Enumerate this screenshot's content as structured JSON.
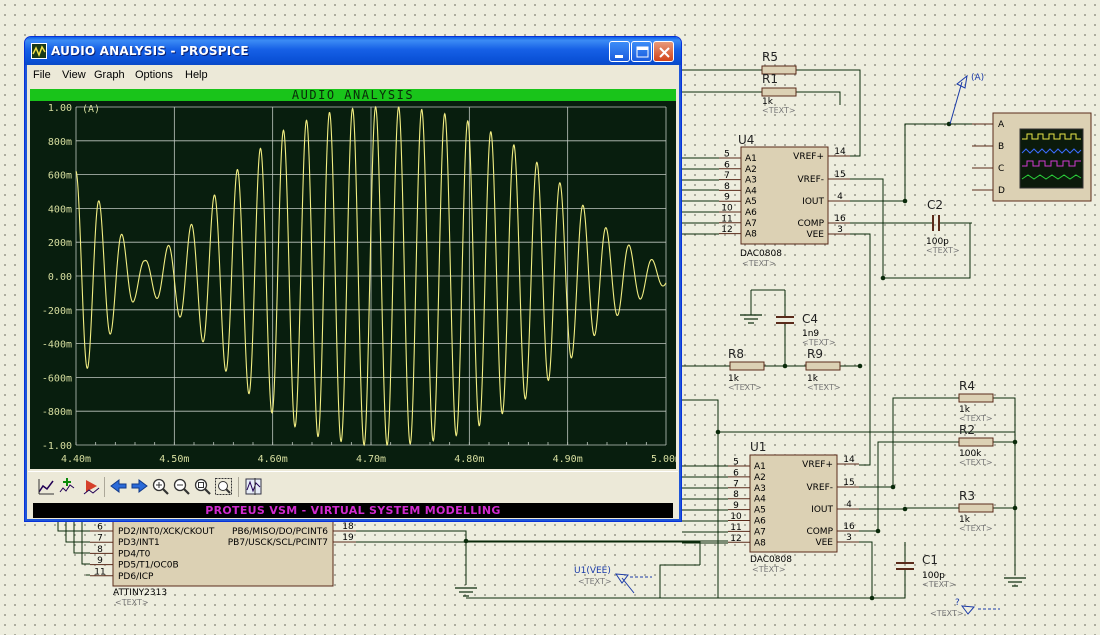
{
  "window": {
    "title": "AUDIO ANALYSIS - PROSPICE",
    "menu": [
      "File",
      "View",
      "Graph",
      "Options",
      "Help"
    ],
    "status": "PROTEUS VSM - VIRTUAL SYSTEM MODELLING",
    "toolbar_icons": [
      "graph-settings-icon",
      "add-trace-icon",
      "run-simulation-icon",
      "pan-left-icon",
      "pan-right-icon",
      "zoom-in-icon",
      "zoom-out-icon",
      "zoom-all-icon",
      "zoom-area-icon",
      "waveform-icon"
    ],
    "controls": {
      "minimize": "minimize-icon",
      "maximize": "maximize-icon",
      "close": "close-icon"
    }
  },
  "graph": {
    "background_color": "#081e0e",
    "header_color": "#19c41a",
    "grid_color": "#bfc7c0",
    "trace_color": "#f2ee82",
    "label_color": "#d8dfa0"
  },
  "chart_data": {
    "type": "line",
    "title": "AUDIO ANALYSIS",
    "trace_label": "(A)",
    "xlim": [
      4.4,
      5.0
    ],
    "ylim": [
      -1.0,
      1.0
    ],
    "x_ticks": [
      "4.40m",
      "4.50m",
      "4.60m",
      "4.70m",
      "4.80m",
      "4.90m",
      "5.00m"
    ],
    "y_ticks": [
      "1.00",
      "800m",
      "600m",
      "400m",
      "200m",
      "0.00",
      "-200m",
      "-400m",
      "-600m",
      "-800m",
      "-1.00"
    ],
    "series": [
      {
        "x_start": 4.4,
        "x_end": 5.0,
        "cycles": 25.6,
        "phase": 1.57,
        "envelope": [
          [
            4.4,
            0.62
          ],
          [
            4.41,
            0.56
          ],
          [
            4.44,
            0.3
          ],
          [
            4.46,
            0.14
          ],
          [
            4.47,
            0.09
          ],
          [
            4.49,
            0.16
          ],
          [
            4.52,
            0.32
          ],
          [
            4.55,
            0.55
          ],
          [
            4.58,
            0.72
          ],
          [
            4.61,
            0.86
          ],
          [
            4.65,
            0.96
          ],
          [
            4.69,
            1.0
          ],
          [
            4.73,
            1.0
          ],
          [
            4.76,
            0.98
          ],
          [
            4.79,
            0.94
          ],
          [
            4.82,
            0.86
          ],
          [
            4.85,
            0.76
          ],
          [
            4.88,
            0.62
          ],
          [
            4.91,
            0.45
          ],
          [
            4.94,
            0.28
          ],
          [
            4.97,
            0.15
          ],
          [
            5.0,
            0.05
          ]
        ]
      }
    ]
  },
  "schematic": {
    "chips": [
      {
        "ref": "U4",
        "part": "DAC0808",
        "text": "<TEXT>",
        "pins_left": [
          "5",
          "6",
          "7",
          "8",
          "9",
          "10",
          "11",
          "12"
        ],
        "names_left": [
          "A1",
          "A2",
          "A3",
          "A4",
          "A5",
          "A6",
          "A7",
          "A8"
        ],
        "pins_right": [
          "14",
          "15",
          "4",
          "16",
          "3"
        ],
        "names_right": [
          "VREF+",
          "VREF-",
          "IOUT",
          "COMP",
          "VEE"
        ]
      },
      {
        "ref": "U1",
        "part": "DAC0808",
        "text": "<TEXT>",
        "pins_left": [
          "5",
          "6",
          "7",
          "8",
          "9",
          "10",
          "11",
          "12"
        ],
        "names_left": [
          "A1",
          "A2",
          "A3",
          "A4",
          "A5",
          "A6",
          "A7",
          "A8"
        ],
        "pins_right": [
          "14",
          "15",
          "4",
          "16",
          "3"
        ],
        "names_right": [
          "VREF+",
          "VREF-",
          "IOUT",
          "COMP",
          "VEE"
        ]
      }
    ],
    "mcu": {
      "part": "ATTINY2313",
      "text": "<TEXT>",
      "pins_left": [
        "6",
        "7",
        "8",
        "9",
        "11"
      ],
      "names_left": [
        "PD2/INT0/XCK/CKOUT",
        "PD3/INT1",
        "PD4/T0",
        "PD5/T1/OC0B",
        "PD6/ICP"
      ],
      "pins_right": [
        "18",
        "19"
      ],
      "names_right": [
        "PB6/MISO/DO/PCINT6",
        "PB7/USCK/SCL/PCINT7"
      ]
    },
    "resistors": [
      {
        "ref": "R5",
        "value": "",
        "text": ""
      },
      {
        "ref": "R1",
        "value": "1k",
        "text": "<TEXT>"
      },
      {
        "ref": "R8",
        "value": "1k",
        "text": "<TEXT>"
      },
      {
        "ref": "R9",
        "value": "1k",
        "text": "<TEXT>"
      },
      {
        "ref": "R4",
        "value": "1k",
        "text": "<TEXT>"
      },
      {
        "ref": "R2",
        "value": "100k",
        "text": "<TEXT>"
      },
      {
        "ref": "R3",
        "value": "1k",
        "text": "<TEXT>"
      }
    ],
    "capacitors": [
      {
        "ref": "C2",
        "value": "100p",
        "text": "<TEXT>"
      },
      {
        "ref": "C4",
        "value": "1n9",
        "text": "<TEXT>"
      },
      {
        "ref": "C1",
        "value": "100p",
        "text": "<TEXT>"
      }
    ],
    "scope_channels": [
      "A",
      "B",
      "C",
      "D"
    ],
    "probes": [
      {
        "label": "(A)"
      },
      {
        "label": "U1(VEE)",
        "text": "<TEXT>"
      },
      {
        "label": "?",
        "text": "<TEXT>"
      }
    ]
  }
}
